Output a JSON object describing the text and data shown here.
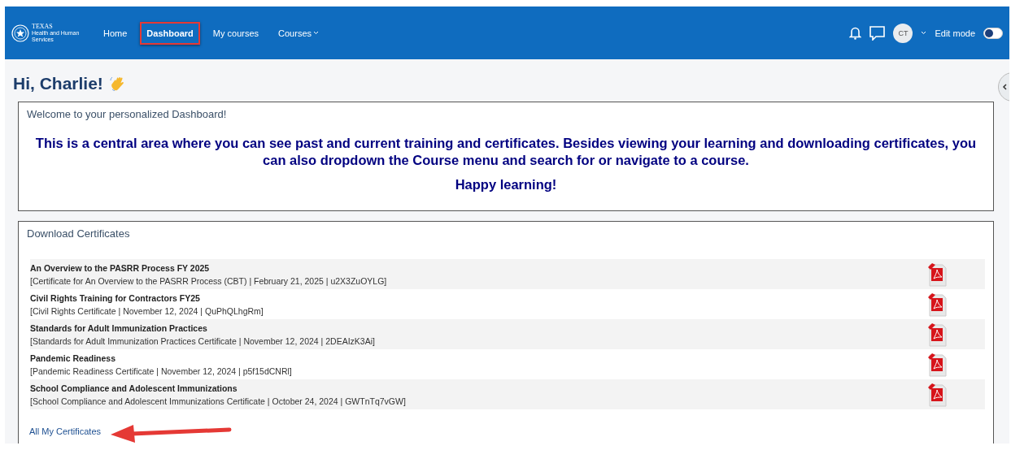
{
  "navbar": {
    "logo_text": "TEXAS",
    "logo_subtext": "Health and Human Services",
    "items": [
      {
        "label": "Home",
        "selected": false,
        "highlighted": false,
        "dropdown": false
      },
      {
        "label": "Dashboard",
        "selected": true,
        "highlighted": true,
        "dropdown": false
      },
      {
        "label": "My courses",
        "selected": false,
        "highlighted": false,
        "dropdown": false
      },
      {
        "label": "Courses",
        "selected": false,
        "highlighted": false,
        "dropdown": true
      }
    ],
    "avatar": "CT",
    "edit_mode": {
      "label": "Edit mode",
      "on": false
    }
  },
  "greeting": "Hi, Charlie!",
  "welcome_card": {
    "title": "Welcome to your personalized Dashboard!",
    "message": "This is a central area where you can see past and current training and certificates. Besides viewing your learning and downloading certificates, you can also dropdown the Course menu and search for or navigate to a course.",
    "closing": "Happy learning!"
  },
  "certificates_card": {
    "title": "Download Certificates",
    "rows": [
      {
        "name": "An Overview to the PASRR Process FY 2025",
        "detail": "[Certificate for An Overview to the PASRR Process (CBT) | February 21, 2025 | u2X3ZuOYLG]"
      },
      {
        "name": "Civil Rights Training for Contractors FY25",
        "detail": "[Civil Rights Certificate | November 12, 2024 | QuPhQLhgRm]"
      },
      {
        "name": "Standards for Adult Immunization Practices",
        "detail": "[Standards for Adult Immunization Practices Certificate | November 12, 2024 | 2DEAIzK3Ai]"
      },
      {
        "name": "Pandemic Readiness",
        "detail": "[Pandemic Readiness Certificate | November 12, 2024 | p5f15dCNRl]"
      },
      {
        "name": "School Compliance and Adolescent Immunizations",
        "detail": "[School Compliance and Adolescent Immunizations Certificate | October 24, 2024 | GWTnTq7vGW]"
      }
    ],
    "link": "All My Certificates"
  }
}
